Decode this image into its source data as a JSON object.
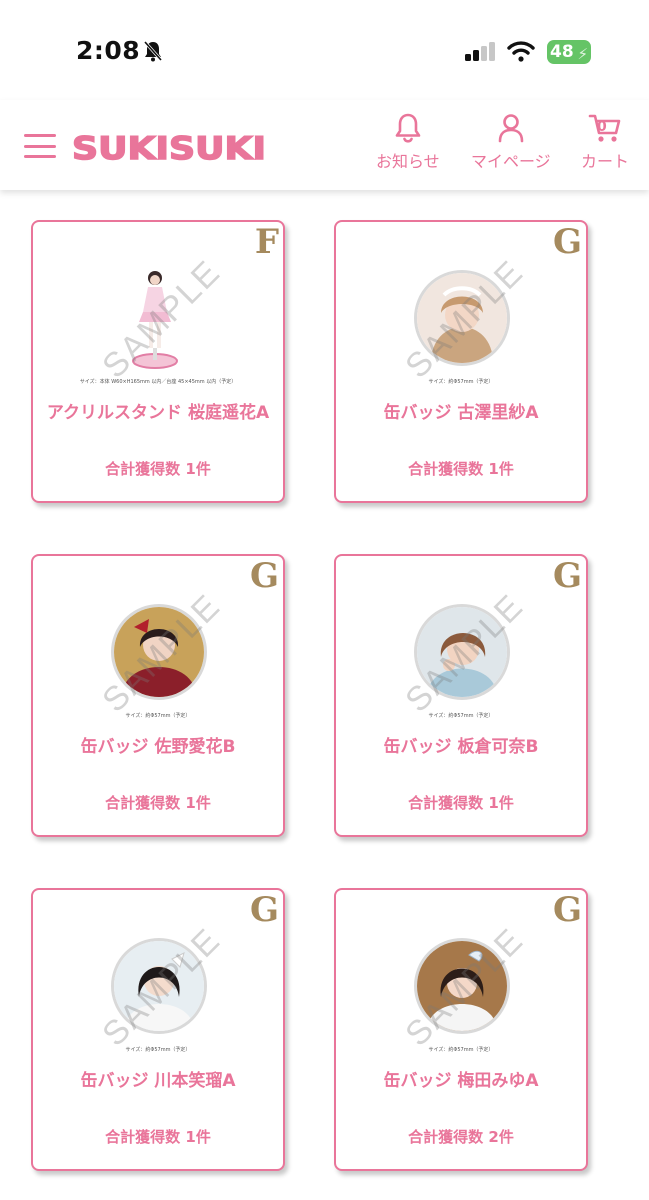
{
  "status_bar": {
    "time": "2:08",
    "battery": "48"
  },
  "header": {
    "brand": "SUKISUKI",
    "notifications_label": "お知らせ",
    "mypage_label": "マイページ",
    "cart_label": "カート",
    "cart_count": "0"
  },
  "colors": {
    "brand_pink": "#e9759a",
    "rank_gold": "#a58a5e"
  },
  "items": [
    {
      "rank": "F",
      "title": "アクリルスタンド 桜庭遥花A",
      "count": "合計獲得数 1件",
      "size_note": "サイズ：本体 W60×H165mm 以内／台座 45×45mm 以内（予定）",
      "watermark": "SAMPLE"
    },
    {
      "rank": "G",
      "title": "缶バッジ 古澤里紗A",
      "count": "合計獲得数 1件",
      "size_note": "サイズ：約Φ57mm（予定）",
      "watermark": "SAMPLE"
    },
    {
      "rank": "G",
      "title": "缶バッジ 佐野愛花B",
      "count": "合計獲得数 1件",
      "size_note": "サイズ：約Φ57mm（予定）",
      "watermark": "SAMPLE"
    },
    {
      "rank": "G",
      "title": "缶バッジ 板倉可奈B",
      "count": "合計獲得数 1件",
      "size_note": "サイズ：約Φ57mm（予定）",
      "watermark": "SAMPLE"
    },
    {
      "rank": "G",
      "title": "缶バッジ 川本笑瑠A",
      "count": "合計獲得数 1件",
      "size_note": "サイズ：約Φ57mm（予定）",
      "watermark": "SAMPLE"
    },
    {
      "rank": "G",
      "title": "缶バッジ 梅田みゆA",
      "count": "合計獲得数 2件",
      "size_note": "サイズ：約Φ57mm（予定）",
      "watermark": "SAMPLE"
    }
  ]
}
